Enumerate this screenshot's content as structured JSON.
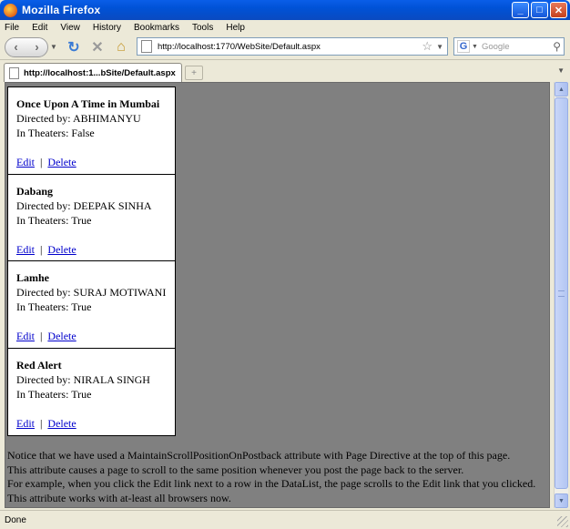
{
  "window": {
    "title": "Mozilla Firefox"
  },
  "menu": [
    "File",
    "Edit",
    "View",
    "History",
    "Bookmarks",
    "Tools",
    "Help"
  ],
  "nav": {
    "back": "‹",
    "forward": "›",
    "url": "http://localhost:1770/WebSite/Default.aspx",
    "search_engine": "G",
    "search_placeholder": "Google"
  },
  "tab": {
    "label": "http://localhost:1...bSite/Default.aspx"
  },
  "movies": [
    {
      "name": "Once Upon A Time in Mumbai",
      "director": "Directed by: ABHIMANYU",
      "in_theaters": "In Theaters: False",
      "edit": "Edit",
      "sep": "|",
      "delete": "Delete"
    },
    {
      "name": "Dabang",
      "director": "Directed by: DEEPAK SINHA",
      "in_theaters": "In Theaters: True",
      "edit": "Edit",
      "sep": "|",
      "delete": "Delete"
    },
    {
      "name": "Lamhe",
      "director": "Directed by: SURAJ MOTIWANI",
      "in_theaters": "In Theaters: True",
      "edit": "Edit",
      "sep": "|",
      "delete": "Delete"
    },
    {
      "name": "Red Alert",
      "director": "Directed by: NIRALA SINGH",
      "in_theaters": "In Theaters: True",
      "edit": "Edit",
      "sep": "|",
      "delete": "Delete"
    }
  ],
  "notice": [
    "Notice that we have used a MaintainScrollPositionOnPostback attribute with Page Directive at the top of this page.",
    "This attribute causes a page to scroll to the same position whenever you post the page back to the server.",
    "For example, when you click the Edit link next to a row in the DataList, the page scrolls to the Edit link that you clicked.",
    "This attribute works with at-least all browsers now."
  ],
  "status": "Done"
}
